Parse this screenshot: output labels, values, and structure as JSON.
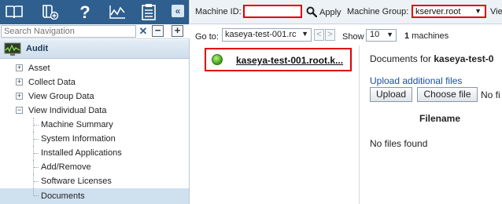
{
  "nav": {
    "toolbar_icons": [
      "book-icon",
      "add-book-icon",
      "help-icon",
      "chart-icon",
      "clipboard-icon"
    ],
    "collapse_glyph": "«",
    "search_placeholder": "Search Navigation",
    "search_clear": "✕",
    "collapse_all": "−",
    "expand_all": "+",
    "module": {
      "label": "Audit",
      "icon": "audit-monitor-icon"
    },
    "tree": [
      {
        "label": "Asset",
        "toggle": "+"
      },
      {
        "label": "Collect Data",
        "toggle": "+"
      },
      {
        "label": "View Group Data",
        "toggle": "+"
      },
      {
        "label": "View Individual Data",
        "toggle": "−"
      }
    ],
    "children": [
      {
        "label": "Machine Summary"
      },
      {
        "label": "System Information"
      },
      {
        "label": "Installed Applications"
      },
      {
        "label": "Add/Remove"
      },
      {
        "label": "Software Licenses"
      },
      {
        "label": "Documents"
      }
    ]
  },
  "filter": {
    "machine_id_label": "Machine ID:",
    "machine_id_value": "",
    "apply_label": "Apply",
    "machine_group_label": "Machine Group:",
    "machine_group_value": "kserver.root",
    "view_label": "View"
  },
  "goto": {
    "label": "Go to:",
    "value": "kaseya-test-001.rc",
    "prev": "<",
    "next": ">",
    "show_label": "Show",
    "show_value": "10",
    "count": "1",
    "count_suffix": "machines"
  },
  "machine": {
    "name": "kaseya-test-001.root.k...",
    "status_color": "#3a9a1b"
  },
  "documents": {
    "title_prefix": "Documents for",
    "title_machine": "kaseya-test-0",
    "upload_link": "Upload additional files",
    "upload_button": "Upload",
    "choose_button": "Choose file",
    "no_file_chosen": "No fi",
    "filename_header": "Filename",
    "empty_text": "No files found"
  },
  "colors": {
    "toolbar": "#2e5f8e",
    "highlight_border": "#e00000",
    "link": "#1a4fa3"
  }
}
